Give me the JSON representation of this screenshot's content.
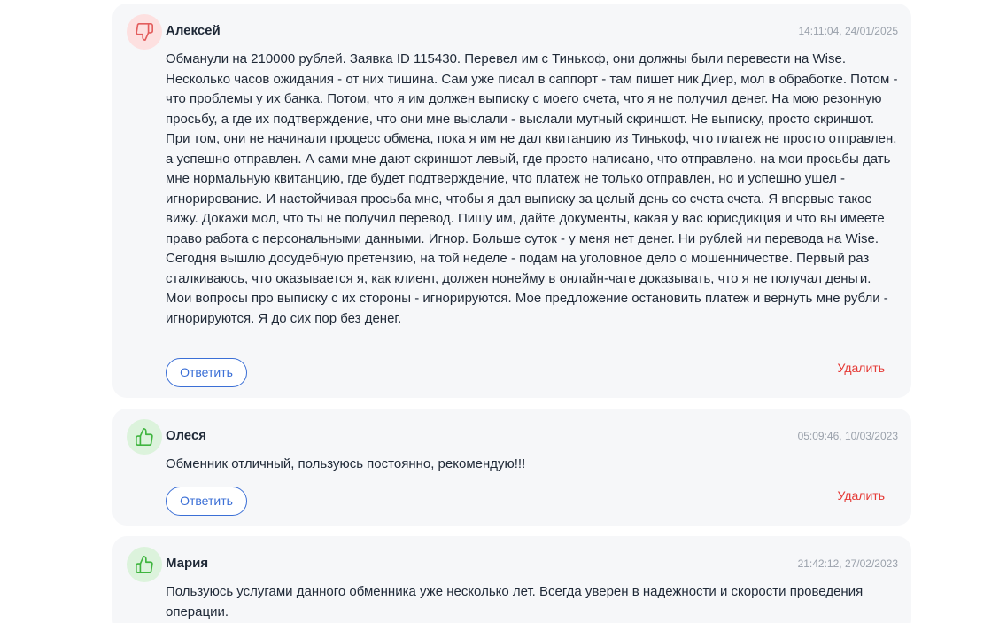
{
  "comments": [
    {
      "rating": "negative",
      "rating_icon": "thumbs-down-icon",
      "rating_color": "#e35d5d",
      "author": "Алексей",
      "timestamp": "14:11:04, 24/01/2025",
      "text": "Обманули на 210000 рублей. Заявка ID 115430. Перевел им с Тинькоф, они должны были перевести на Wise. Несколько часов ожидания - от них тишина. Сам уже писал в саппорт - там пишет ник Диер, мол в обработке. Потом - что проблемы у их банка. Потом, что я им должен выписку с моего счета, что я не получил денег. На мою резонную просьбу, а где их подтверждение, что они мне выслали - выслали мутный скриншот. Не выписку, просто скриншот. При том, они не начинали процесс обмена, пока я им не дал квитанцию из Тинькоф, что платеж не просто отправлен, а успешно отправлен. А сами мне дают скриншот левый, где просто написано, что отправлено. на мои просьбы дать мне нормальную квитанцию, где будет подтверждение, что платеж не только отправлен, но и успешно ушел - игнорирование. И настойчивая просьба мне, чтобы я дал выписку за целый день со счета счета. Я впервые такое вижу. Докажи мол, что ты не получил перевод. Пишу им, дайте документы, какая у вас юрисдикция и что вы имеете право работа с персональными данными. Игнор. Больше суток - у меня нет денег. Ни рублей ни перевода на Wise. Сегодня вышлю досудебную претензию, на той неделе - подам на уголовное дело о мошенничестве. Первый раз сталкиваюсь, что оказывается я, как клиент, должен нонейму в онлайн-чате доказывать, что я не получал деньги. Мои вопросы про выписку с их стороны - игнорируются. Мое предложение остановить платеж и вернуть мне рубли - игнорируются. Я до сих пор без денег.",
      "reply_label": "Ответить",
      "delete_label": "Удалить"
    },
    {
      "rating": "positive",
      "rating_icon": "thumbs-up-icon",
      "rating_color": "#3fb53f",
      "author": "Олеся",
      "timestamp": "05:09:46, 10/03/2023",
      "text": "Обменник отличный, пользуюсь постоянно, рекомендую!!!",
      "reply_label": "Ответить",
      "delete_label": "Удалить"
    },
    {
      "rating": "positive",
      "rating_icon": "thumbs-up-icon",
      "rating_color": "#3fb53f",
      "author": "Мария",
      "timestamp": "21:42:12, 27/02/2023",
      "text": "Пользуюсь услугами данного обменника уже несколько лет. Всегда уверен в надежности и скорости проведения операции."
    }
  ],
  "colors": {
    "card_background": "#f6f7f9",
    "accent_blue": "#3b6fd6",
    "delete_red": "#e53935",
    "timestamp_gray": "#9aa1ab"
  }
}
